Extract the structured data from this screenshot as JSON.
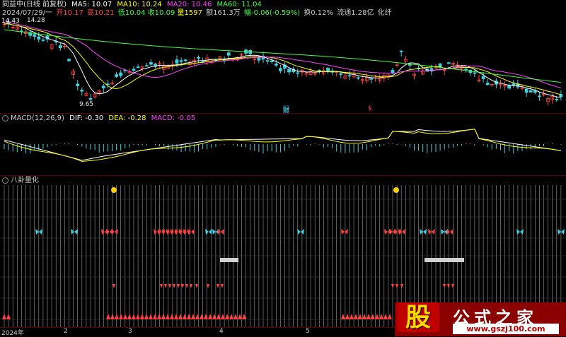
{
  "header": {
    "stock": "同益中(日线 前复权)",
    "ma5": "MA5: 10.07",
    "ma10": "MA10: 10.24",
    "ma20": "MA20: 10.46",
    "ma60": "MA60: 11.04",
    "date": "2024/07/29/一",
    "open": "开10.17",
    "high": "高10.21",
    "low": "低10.04",
    "close": "收10.09",
    "vol": "量1597",
    "amount": "额161.3万",
    "change": "幅-0.06(-0.59%)",
    "turnover": "换0.12%",
    "float": "流通1.28亿",
    "industry": "化纤"
  },
  "price_panel": {
    "high_label": "14.28",
    "low_label": "9.65",
    "left_tag": "14.43",
    "marker_cai": "财",
    "marker_s": "$"
  },
  "macd_panel": {
    "title": "MACD(12,26,9)",
    "dif": "DIF: -0.30",
    "dea": "DEA: -0.28",
    "macd": "MACD: -0.05"
  },
  "bagua_panel": {
    "title": "八卦量化"
  },
  "x_axis": {
    "labels": [
      "2024年",
      "2",
      "3",
      "4",
      "5"
    ]
  },
  "logo": {
    "char": "股",
    "name": "公式之家",
    "url": "www.gszj100.com"
  },
  "colors": {
    "up": "#ff4040",
    "down": "#3fd0e0",
    "ma5": "#ffffff",
    "ma10": "#ffff00",
    "ma20": "#ff40ff",
    "ma60": "#40ff40",
    "separator": "#5a0000"
  }
}
